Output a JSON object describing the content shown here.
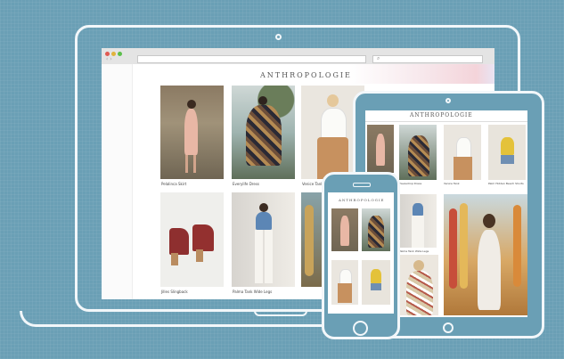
{
  "brand": "ANTHROPOLOGIE",
  "laptop": {
    "products": [
      {
        "name": "Pelalinca Skirt"
      },
      {
        "name": "Everylife Dress"
      },
      {
        "name": "Venice Tank"
      },
      {
        "name": "Jilles Slingback"
      },
      {
        "name": "Palma Tank Wide Legs"
      }
    ]
  },
  "tablet": {
    "products": [
      {
        "name": "Eavesdrop Dress"
      },
      {
        "name": "Venice Tank"
      },
      {
        "name": "Palm Hidden Beach Shorts"
      },
      {
        "name": "Palma Tank Wide Legs"
      }
    ]
  },
  "phone": {
    "products": []
  },
  "colors": {
    "background": "#6a9fb5",
    "device_outline": "#f2f7fa"
  }
}
